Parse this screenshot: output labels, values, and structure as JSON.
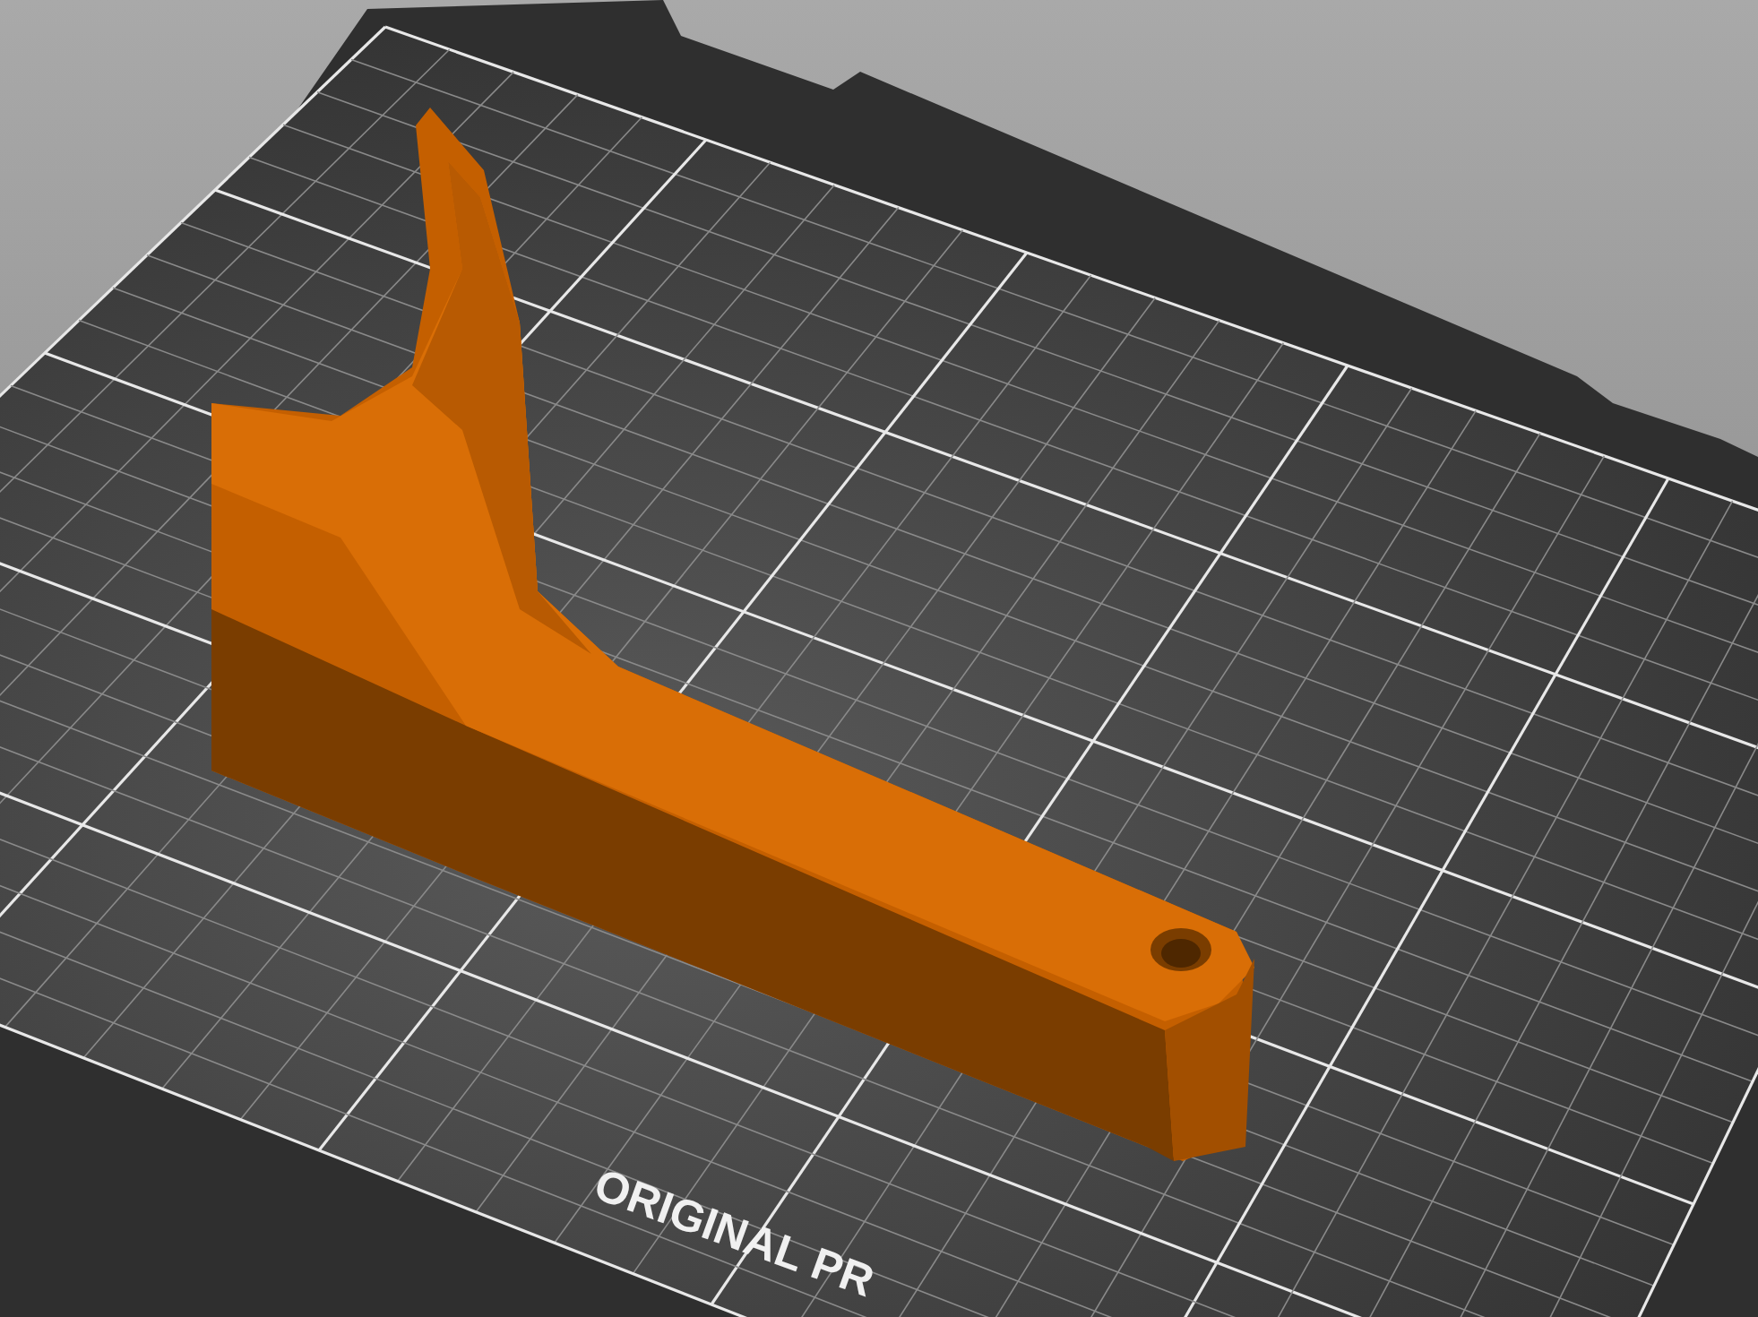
{
  "viewport": {
    "bed_label": "ORIGINAL PR"
  }
}
